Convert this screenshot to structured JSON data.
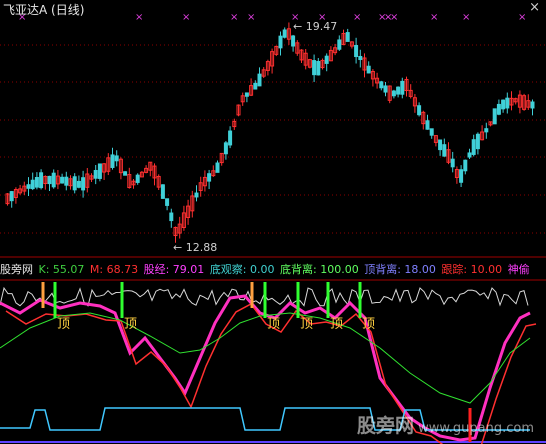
{
  "header": {
    "ticker": "飞亚达A",
    "period": "(日线)",
    "close_glyph": "×"
  },
  "price_panel": {
    "high_label": "19.47",
    "low_label": "12.88",
    "colors": {
      "up": "#ff3030",
      "down": "#40d0d8",
      "grid": "#8b0000",
      "marker": "#e040e0"
    }
  },
  "indicator_bar": {
    "name": "股旁网",
    "items": [
      {
        "label": "K: 55.07",
        "color": "#40d040"
      },
      {
        "label": "M: 68.73",
        "color": "#ff3030"
      },
      {
        "label": "股经: 79.01",
        "color": "#ff40ff"
      },
      {
        "label": "底观察: 0.00",
        "color": "#40d0d0"
      },
      {
        "label": "底背离: 100.00",
        "color": "#60ff60"
      },
      {
        "label": "顶背离: 18.00",
        "color": "#8080ff"
      },
      {
        "label": "跟踪: 10.00",
        "color": "#ff3030"
      },
      {
        "label": "神偷",
        "color": "#ff40ff"
      }
    ]
  },
  "indicator_panel": {
    "top_label": "顶",
    "top_markers": 5
  },
  "watermark": {
    "text": "股旁网",
    "domain": "www.gupang.com"
  }
}
